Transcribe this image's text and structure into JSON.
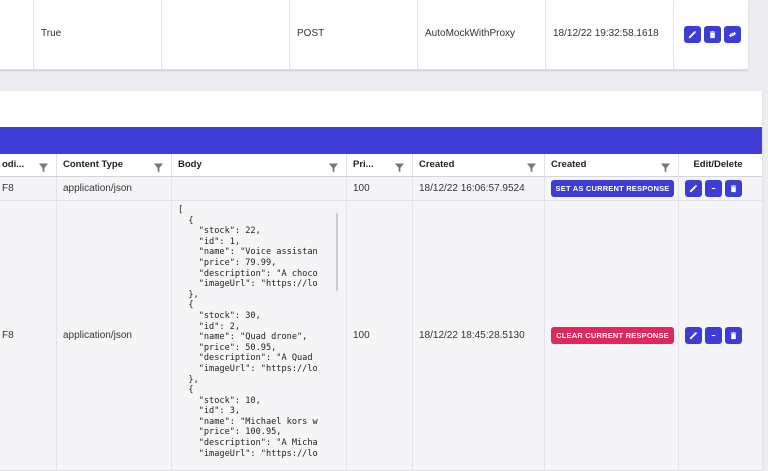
{
  "top_row": {
    "cells": [
      "",
      "True",
      "",
      "POST",
      "AutoMockWithProxy",
      "18/12/22 19:32:58.1618"
    ]
  },
  "table": {
    "headers": [
      "odi...",
      "Content Type",
      "Body",
      "Pri...",
      "Created",
      "Created",
      "Edit/Delete"
    ],
    "rows": [
      {
        "encoding": "F8",
        "content_type": "application/json",
        "body": "",
        "priority": "100",
        "created": "18/12/22 16:06:57.9524",
        "action_label": "SET AS CURRENT RESPONSE"
      },
      {
        "encoding": "F8",
        "content_type": "application/json",
        "body": "[\n  {\n    \"stock\": 22,\n    \"id\": 1,\n    \"name\": \"Voice assistan\n    \"price\": 79.99,\n    \"description\": \"A choco\n    \"imageUrl\": \"https://lo\n  },\n  {\n    \"stock\": 30,\n    \"id\": 2,\n    \"name\": \"Quad drone\",\n    \"price\": 50.95,\n    \"description\": \"A Quad\n    \"imageUrl\": \"https://lo\n  },\n  {\n    \"stock\": 10,\n    \"id\": 3,\n    \"name\": \"Michael kors w\n    \"price\": 100.95,\n    \"description\": \"A Micha\n    \"imageUrl\": \"https://lo",
        "priority": "100",
        "created": "18/12/22 18:45:28.5130",
        "action_label": "CLEAR CURRENT RESPONSE"
      }
    ]
  },
  "colors": {
    "accent": "#3f3fd8",
    "danger": "#e2275a"
  },
  "icons": [
    "pencil-icon",
    "delete-icon",
    "swap-icon",
    "minus-icon",
    "filter-icon"
  ]
}
